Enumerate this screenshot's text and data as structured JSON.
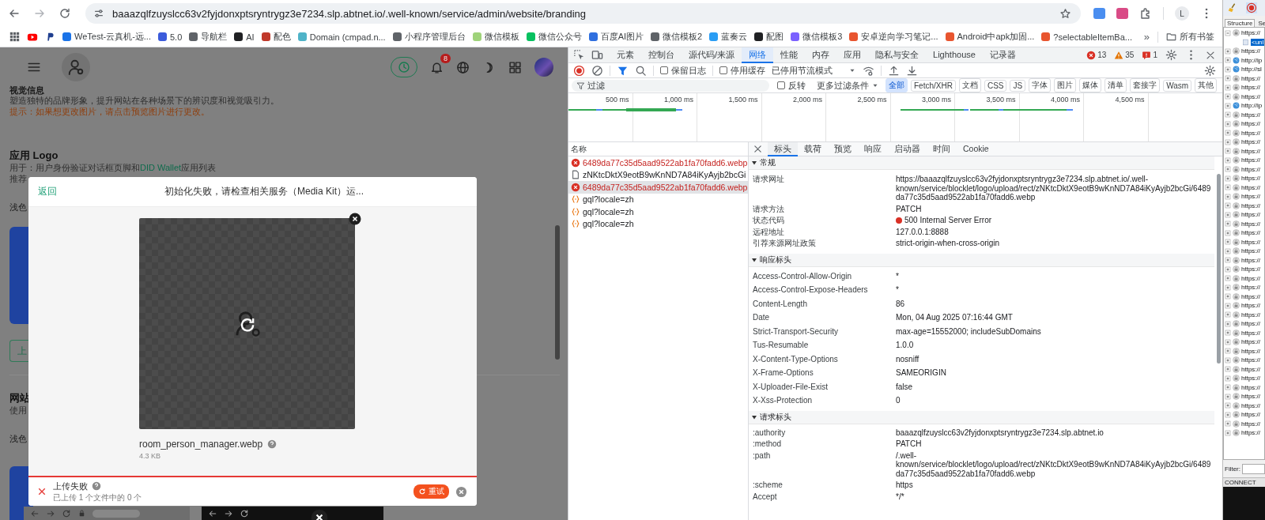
{
  "browser": {
    "url": "baaazqlfzuyslcc63v2fyjdonxptsryntrygz3e7234.slp.abtnet.io/.well-known/service/admin/website/branding",
    "profile_initial": "L",
    "bookmarks": [
      {
        "label": "WeTest-云真机-远...",
        "color": "#1a73e8"
      },
      {
        "label": "5.0",
        "color": "#3b5bdb"
      },
      {
        "label": "导航栏",
        "color": "#5f6368"
      },
      {
        "label": "AI",
        "color": "#202124"
      },
      {
        "label": "配色",
        "color": "#c0392b"
      },
      {
        "label": "Domain (cmpad.n...",
        "color": "#4fb3c8"
      },
      {
        "label": "小程序管理后台",
        "color": "#5f6368"
      },
      {
        "label": "微信模板",
        "color": "#9fd37a"
      },
      {
        "label": "微信公众号",
        "color": "#07c160"
      },
      {
        "label": "百度AI图片",
        "color": "#2f6fdf"
      },
      {
        "label": "微信模板2",
        "color": "#5f6368"
      },
      {
        "label": "蓝奏云",
        "color": "#2a9df4"
      },
      {
        "label": "配图",
        "color": "#202124"
      },
      {
        "label": "微信模板3",
        "color": "#7b61ff"
      },
      {
        "label": "安卓逆向学习笔记...",
        "color": "#e8552f"
      },
      {
        "label": "Android中apk加固...",
        "color": "#e8552f"
      },
      {
        "label": "?selectableItemBa...",
        "color": "#e8552f"
      }
    ],
    "more": "»",
    "all_bookmarks": "所有书签"
  },
  "page": {
    "notifications": "8",
    "section_title": "视觉信息",
    "description": "塑造独特的品牌形象，提升网站在各种场景下的辨识度和视觉吸引力。",
    "hint": "提示：如果想更改图片，请点击预览图片进行更改。",
    "logo_title": "应用 Logo",
    "usage_prefix": "用于：用户身份验证对话框页脚和",
    "usage_link": "DID Wallet",
    "usage_suffix": "应用列表",
    "recommend": "推荐",
    "light_label": "浅色",
    "upload_button": "上",
    "website_title": "网站",
    "website_usage": "使用",
    "light_label_2": "浅色"
  },
  "modal": {
    "back": "返回",
    "title": "初始化失败，请检查相关服务（Media Kit）运...",
    "file_name": "room_person_manager.webp",
    "file_size": "4.3 KB",
    "status_title": "上传失败",
    "status_detail": "已上传 1 个文件中的 0 个",
    "retry": "重试"
  },
  "devtools": {
    "tabs": [
      {
        "label": "元素",
        "selected": false
      },
      {
        "label": "控制台",
        "selected": false
      },
      {
        "label": "源代码/来源",
        "selected": false
      },
      {
        "label": "网络",
        "selected": true
      },
      {
        "label": "性能",
        "selected": false
      },
      {
        "label": "内存",
        "selected": false
      },
      {
        "label": "应用",
        "selected": false
      },
      {
        "label": "隐私与安全",
        "selected": false
      },
      {
        "label": "Lighthouse",
        "selected": false
      },
      {
        "label": "记录器",
        "selected": false
      }
    ],
    "errors": "13",
    "warnings": "35",
    "issues": "1",
    "preserve_log": {
      "label": "保留日志",
      "checked": false
    },
    "disable_cache": {
      "label": "停用缓存",
      "checked": false
    },
    "throttling": "已停用节流模式",
    "filter_placeholder": "过滤",
    "invert": {
      "label": "反转",
      "checked": false
    },
    "more_filters": "更多过滤条件",
    "types": [
      {
        "label": "全部",
        "selected": true
      },
      {
        "label": "Fetch/XHR",
        "selected": false
      },
      {
        "label": "文档",
        "selected": false
      },
      {
        "label": "CSS",
        "selected": false
      },
      {
        "label": "JS",
        "selected": false
      },
      {
        "label": "字体",
        "selected": false
      },
      {
        "label": "图片",
        "selected": false
      },
      {
        "label": "媒体",
        "selected": false
      },
      {
        "label": "清单",
        "selected": false
      },
      {
        "label": "套接字",
        "selected": false
      },
      {
        "label": "Wasm",
        "selected": false
      },
      {
        "label": "其他",
        "selected": false
      }
    ],
    "ticks": [
      "500 ms",
      "1,000 ms",
      "1,500 ms",
      "2,000 ms",
      "2,500 ms",
      "3,000 ms",
      "3,500 ms",
      "4,000 ms",
      "4,500 ms"
    ],
    "name_column": "名称",
    "requests": [
      {
        "name": "6489da77c35d5aad9522ab1fa70fadd6.webp",
        "kind": "error",
        "selected": false
      },
      {
        "name": "zNKtcDktX9eotB9wKnND7A84iKyAyjb2bcGi",
        "kind": "document",
        "selected": false
      },
      {
        "name": "6489da77c35d5aad9522ab1fa70fadd6.webp",
        "kind": "error",
        "selected": true
      },
      {
        "name": "gql?locale=zh",
        "kind": "fetch",
        "selected": false
      },
      {
        "name": "gql?locale=zh",
        "kind": "fetch",
        "selected": false
      },
      {
        "name": "gql?locale=zh",
        "kind": "fetch",
        "selected": false
      }
    ],
    "detail_tabs": [
      {
        "label": "标头",
        "selected": true
      },
      {
        "label": "载荷",
        "selected": false
      },
      {
        "label": "预览",
        "selected": false
      },
      {
        "label": "响应",
        "selected": false
      },
      {
        "label": "启动器",
        "selected": false
      },
      {
        "label": "时间",
        "selected": false
      },
      {
        "label": "Cookie",
        "selected": false
      }
    ],
    "sections": [
      {
        "title": "常规",
        "expanded": true,
        "rows": [
          {
            "name": "请求网址",
            "value": "https://baaazqlfzuyslcc63v2fyjdonxptsryntrygz3e7234.slp.abtnet.io/.well-known/service/blocklet/logo/upload/rect/zNKtcDktX9eotB9wKnND7A84iKyAyjb2bcGi/6489da77c35d5aad9522ab1fa70fadd6.webp"
          },
          {
            "name": "请求方法",
            "value": "PATCH"
          },
          {
            "name": "状态代码",
            "value": "500 Internal Server Error",
            "color": "#d93025"
          },
          {
            "name": "远程地址",
            "value": "127.0.0.1:8888"
          },
          {
            "name": "引荐来源网址政策",
            "value": "strict-origin-when-cross-origin"
          }
        ]
      },
      {
        "title": "响应标头",
        "expanded": true,
        "rows": [
          {
            "name": "Access-Control-Allow-Origin",
            "value": "*"
          },
          {
            "name": "Access-Control-Expose-Headers",
            "value": "*"
          },
          {
            "name": "Content-Length",
            "value": "86"
          },
          {
            "name": "Date",
            "value": "Mon, 04 Aug 2025 07:16:44 GMT"
          },
          {
            "name": "Strict-Transport-Security",
            "value": "max-age=15552000; includeSubDomains"
          },
          {
            "name": "Tus-Resumable",
            "value": "1.0.0"
          },
          {
            "name": "X-Content-Type-Options",
            "value": "nosniff"
          },
          {
            "name": "X-Frame-Options",
            "value": "SAMEORIGIN"
          },
          {
            "name": "X-Uploader-File-Exist",
            "value": "false"
          },
          {
            "name": "X-Xss-Protection",
            "value": "0"
          }
        ]
      },
      {
        "title": "请求标头",
        "expanded": true,
        "rows": [
          {
            "name": ":authority",
            "value": "baaazqlfzuyslcc63v2fyjdonxptsryntrygz3e7234.slp.abtnet.io"
          },
          {
            "name": ":method",
            "value": "PATCH"
          },
          {
            "name": ":path",
            "value": "/.well-known/service/blocklet/logo/upload/rect/zNKtcDktX9eotB9wKnND7A84iKyAyjb2bcGi/6489da77c35d5aad9522ab1fa70fadd6.webp"
          },
          {
            "name": ":scheme",
            "value": "https"
          },
          {
            "name": "Accept",
            "value": "*/*"
          }
        ]
      }
    ]
  },
  "fiddler": {
    "tabs": [
      {
        "label": "Structure",
        "selected": true
      },
      {
        "label": "Se",
        "selected": false
      }
    ],
    "filter_label": "Filter:",
    "status": "CONNECT",
    "rows": [
      {
        "text": "https://",
        "kind": "secure",
        "expanded": true,
        "selected": false,
        "children": [
          {
            "text": "<unl",
            "kind": "page",
            "selected": true
          }
        ]
      },
      {
        "text": "https://",
        "kind": "secure",
        "expanded": false,
        "selected": false
      },
      {
        "text": "http://ip",
        "kind": "plain",
        "expanded": false,
        "selected": false
      },
      {
        "text": "http://sl",
        "kind": "plain",
        "expanded": false,
        "selected": false
      },
      {
        "text": "https://",
        "kind": "secure",
        "expanded": false,
        "selected": false
      },
      {
        "text": "https://",
        "kind": "secure",
        "expanded": false,
        "selected": false
      },
      {
        "text": "https://",
        "kind": "secure",
        "expanded": false,
        "selected": false
      },
      {
        "text": "http://ip",
        "kind": "plain",
        "expanded": false,
        "selected": false
      },
      {
        "text": "https://",
        "kind": "secure",
        "expanded": false,
        "selected": false
      },
      {
        "text": "https://",
        "kind": "secure",
        "expanded": false,
        "selected": false
      },
      {
        "text": "https://",
        "kind": "secure",
        "expanded": false,
        "selected": false
      },
      {
        "text": "https://",
        "kind": "secure",
        "expanded": false,
        "selected": false
      },
      {
        "text": "https://",
        "kind": "secure",
        "expanded": false,
        "selected": false
      },
      {
        "text": "https://",
        "kind": "secure",
        "expanded": false,
        "selected": false
      },
      {
        "text": "https://",
        "kind": "secure",
        "expanded": false,
        "selected": false
      },
      {
        "text": "https://",
        "kind": "secure",
        "expanded": false,
        "selected": false
      },
      {
        "text": "https://",
        "kind": "secure",
        "expanded": false,
        "selected": false
      },
      {
        "text": "https://",
        "kind": "secure",
        "expanded": false,
        "selected": false
      },
      {
        "text": "https://",
        "kind": "secure",
        "expanded": false,
        "selected": false
      },
      {
        "text": "https://",
        "kind": "secure",
        "expanded": false,
        "selected": false
      },
      {
        "text": "https://",
        "kind": "secure",
        "expanded": false,
        "selected": false
      },
      {
        "text": "https://",
        "kind": "secure",
        "expanded": false,
        "selected": false
      },
      {
        "text": "https://",
        "kind": "secure",
        "expanded": false,
        "selected": false
      },
      {
        "text": "https://",
        "kind": "secure",
        "expanded": false,
        "selected": false
      },
      {
        "text": "https://",
        "kind": "secure",
        "expanded": false,
        "selected": false
      },
      {
        "text": "https://",
        "kind": "secure",
        "expanded": false,
        "selected": false
      },
      {
        "text": "https://",
        "kind": "secure",
        "expanded": false,
        "selected": false
      },
      {
        "text": "https://",
        "kind": "secure",
        "expanded": false,
        "selected": false
      },
      {
        "text": "https://",
        "kind": "secure",
        "expanded": false,
        "selected": false
      },
      {
        "text": "https://",
        "kind": "secure",
        "expanded": false,
        "selected": false
      },
      {
        "text": "https://",
        "kind": "secure",
        "expanded": false,
        "selected": false
      },
      {
        "text": "https://",
        "kind": "secure",
        "expanded": false,
        "selected": false
      },
      {
        "text": "https://",
        "kind": "secure",
        "expanded": false,
        "selected": false
      },
      {
        "text": "https://",
        "kind": "secure",
        "expanded": false,
        "selected": false
      },
      {
        "text": "https://",
        "kind": "secure",
        "expanded": false,
        "selected": false
      },
      {
        "text": "https://",
        "kind": "secure",
        "expanded": false,
        "selected": false
      },
      {
        "text": "https://",
        "kind": "secure",
        "expanded": false,
        "selected": false
      },
      {
        "text": "https://",
        "kind": "secure",
        "expanded": false,
        "selected": false
      },
      {
        "text": "https://",
        "kind": "secure",
        "expanded": false,
        "selected": false
      },
      {
        "text": "https://",
        "kind": "secure",
        "expanded": false,
        "selected": false
      },
      {
        "text": "https://",
        "kind": "secure",
        "expanded": false,
        "selected": false
      },
      {
        "text": "https://",
        "kind": "secure",
        "expanded": false,
        "selected": false
      },
      {
        "text": "https://",
        "kind": "secure",
        "expanded": false,
        "selected": false
      },
      {
        "text": "https://",
        "kind": "secure",
        "expanded": false,
        "selected": false
      }
    ]
  }
}
